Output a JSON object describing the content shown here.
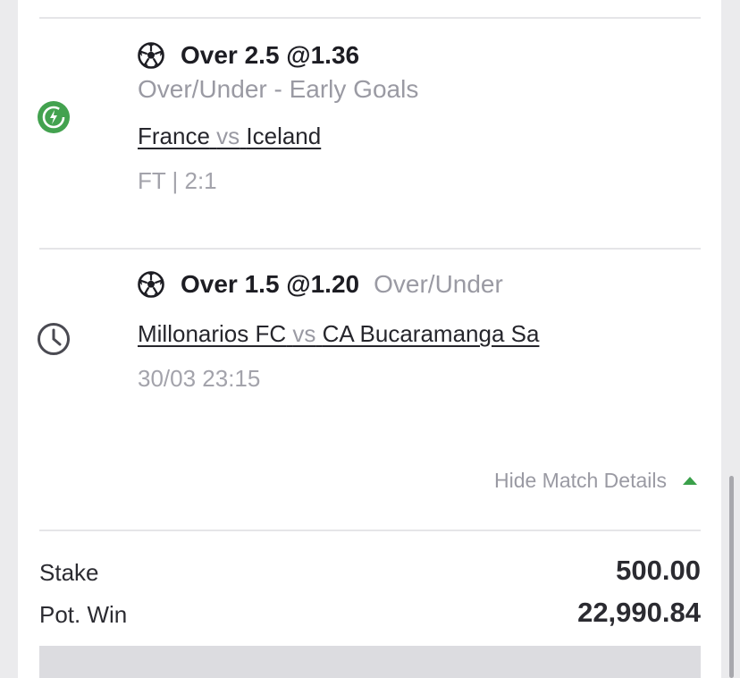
{
  "bets": [
    {
      "selection": "Over 2.5 @1.36",
      "market": "Over/Under  -  Early Goals",
      "home": "France",
      "vs": "vs",
      "away": "Iceland",
      "meta": "FT | 2:1",
      "status_icon": "green-refresh-won-icon",
      "sport_icon": "soccer-ball-icon"
    },
    {
      "selection": "Over 1.5 @1.20",
      "market": "Over/Under",
      "home": "Millonarios FC",
      "vs": "vs",
      "away": "CA Bucaramanga Sa",
      "meta": "30/03 23:15",
      "status_icon": "clock-icon",
      "sport_icon": "soccer-ball-icon"
    }
  ],
  "hide_details_label": "Hide Match Details",
  "summary": {
    "stake_label": "Stake",
    "stake_value": "500.00",
    "pot_win_label": "Pot. Win",
    "pot_win_value": "22,990.84"
  },
  "colors": {
    "accent_green": "#3aa04a",
    "muted_text": "#9a9aa3",
    "primary_text": "#1d1d23"
  }
}
